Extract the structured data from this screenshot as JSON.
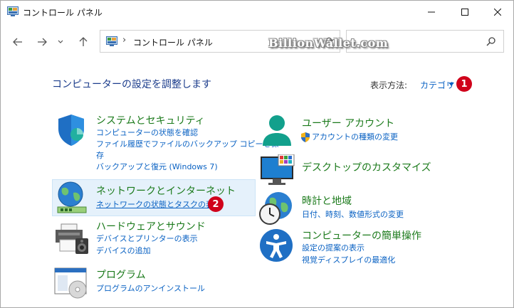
{
  "window": {
    "title": "コントロール パネル",
    "minimize_label": "",
    "maximize_label": "",
    "close_label": ""
  },
  "address": {
    "separator": "›",
    "path": "コントロール パネル"
  },
  "search": {
    "placeholder": ""
  },
  "watermark": "BillionWallet.com",
  "header": {
    "title": "コンピューターの設定を調整します",
    "view_by_label": "表示方法:",
    "view_by_value": "カテゴリ",
    "badge1": "1"
  },
  "categories": {
    "security": {
      "title": "システムとセキュリティ",
      "links": [
        "コンピューターの状態を確認",
        "ファイル履歴でファイルのバックアップ コピーを保",
        "存",
        "バックアップと復元 (Windows 7)"
      ]
    },
    "network": {
      "title": "ネットワークとインターネット",
      "links": [
        "ネットワークの状態とタスクの表示"
      ],
      "badge": "2"
    },
    "hardware": {
      "title": "ハードウェアとサウンド",
      "links": [
        "デバイスとプリンターの表示",
        "デバイスの追加"
      ]
    },
    "programs": {
      "title": "プログラム",
      "links": [
        "プログラムのアンインストール"
      ]
    },
    "user_accounts": {
      "title": "ユーザー アカウント",
      "links": [
        "アカウントの種類の変更"
      ]
    },
    "desktop": {
      "title": "デスクトップのカスタマイズ",
      "links": []
    },
    "clock": {
      "title": "時計と地域",
      "links": [
        "日付、時刻、数値形式の変更"
      ]
    },
    "ease": {
      "title": "コンピューターの簡単操作",
      "links": [
        "設定の提案の表示",
        "視覚ディスプレイの最適化"
      ]
    }
  },
  "colors": {
    "category_title": "#1b7a1b",
    "link": "#0a62c3",
    "heading": "#1c3d8c",
    "badge": "#d0021b"
  }
}
